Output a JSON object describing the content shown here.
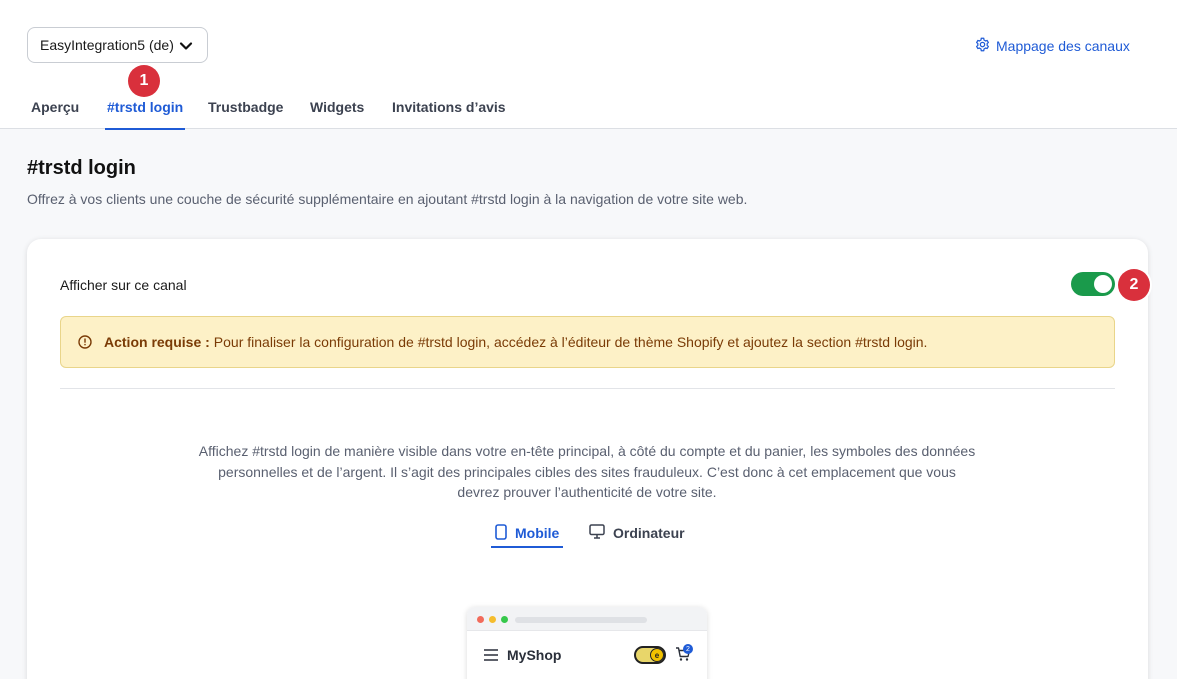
{
  "header": {
    "shop_selector": "EasyIntegration5 (de)",
    "channel_mapping": "Mappage des canaux"
  },
  "tabs": [
    {
      "label": "Aperçu",
      "active": false
    },
    {
      "label": "#trstd login",
      "active": true
    },
    {
      "label": "Trustbadge",
      "active": false
    },
    {
      "label": "Widgets",
      "active": false
    },
    {
      "label": "Invitations d’avis",
      "active": false
    }
  ],
  "annotations": [
    "1",
    "2"
  ],
  "page": {
    "title": "#trstd login",
    "subtitle": "Offrez à vos clients une couche de sécurité supplémentaire en ajoutant #trstd login à la navigation de votre site web."
  },
  "card": {
    "show_on_channel": "Afficher sur ce canal",
    "toggle_on": true,
    "alert_label": "Action requise :",
    "alert_text": "Pour finaliser la configuration de #trstd login, accédez à l’éditeur de thème Shopify et ajoutez la section #trstd login.",
    "description": "Affichez #trstd login de manière visible dans votre en-tête principal, à côté du compte et du panier, les symboles des données personnelles et de l’argent. Il s’agit des principales cibles des sites frauduleux. C’est donc à cet emplacement que vous devrez prouver l’authenticité de votre site.",
    "view_tabs": [
      {
        "label": "Mobile",
        "active": true
      },
      {
        "label": "Ordinateur",
        "active": false
      }
    ]
  },
  "preview": {
    "shop_name": "MyShop",
    "cart_count": "2"
  },
  "colors": {
    "accent": "#1f5bd6",
    "toggle": "#1a9a4b",
    "annotation": "#d9303c",
    "alert_bg": "#fdf1c7",
    "alert_text": "#7a3b06"
  }
}
